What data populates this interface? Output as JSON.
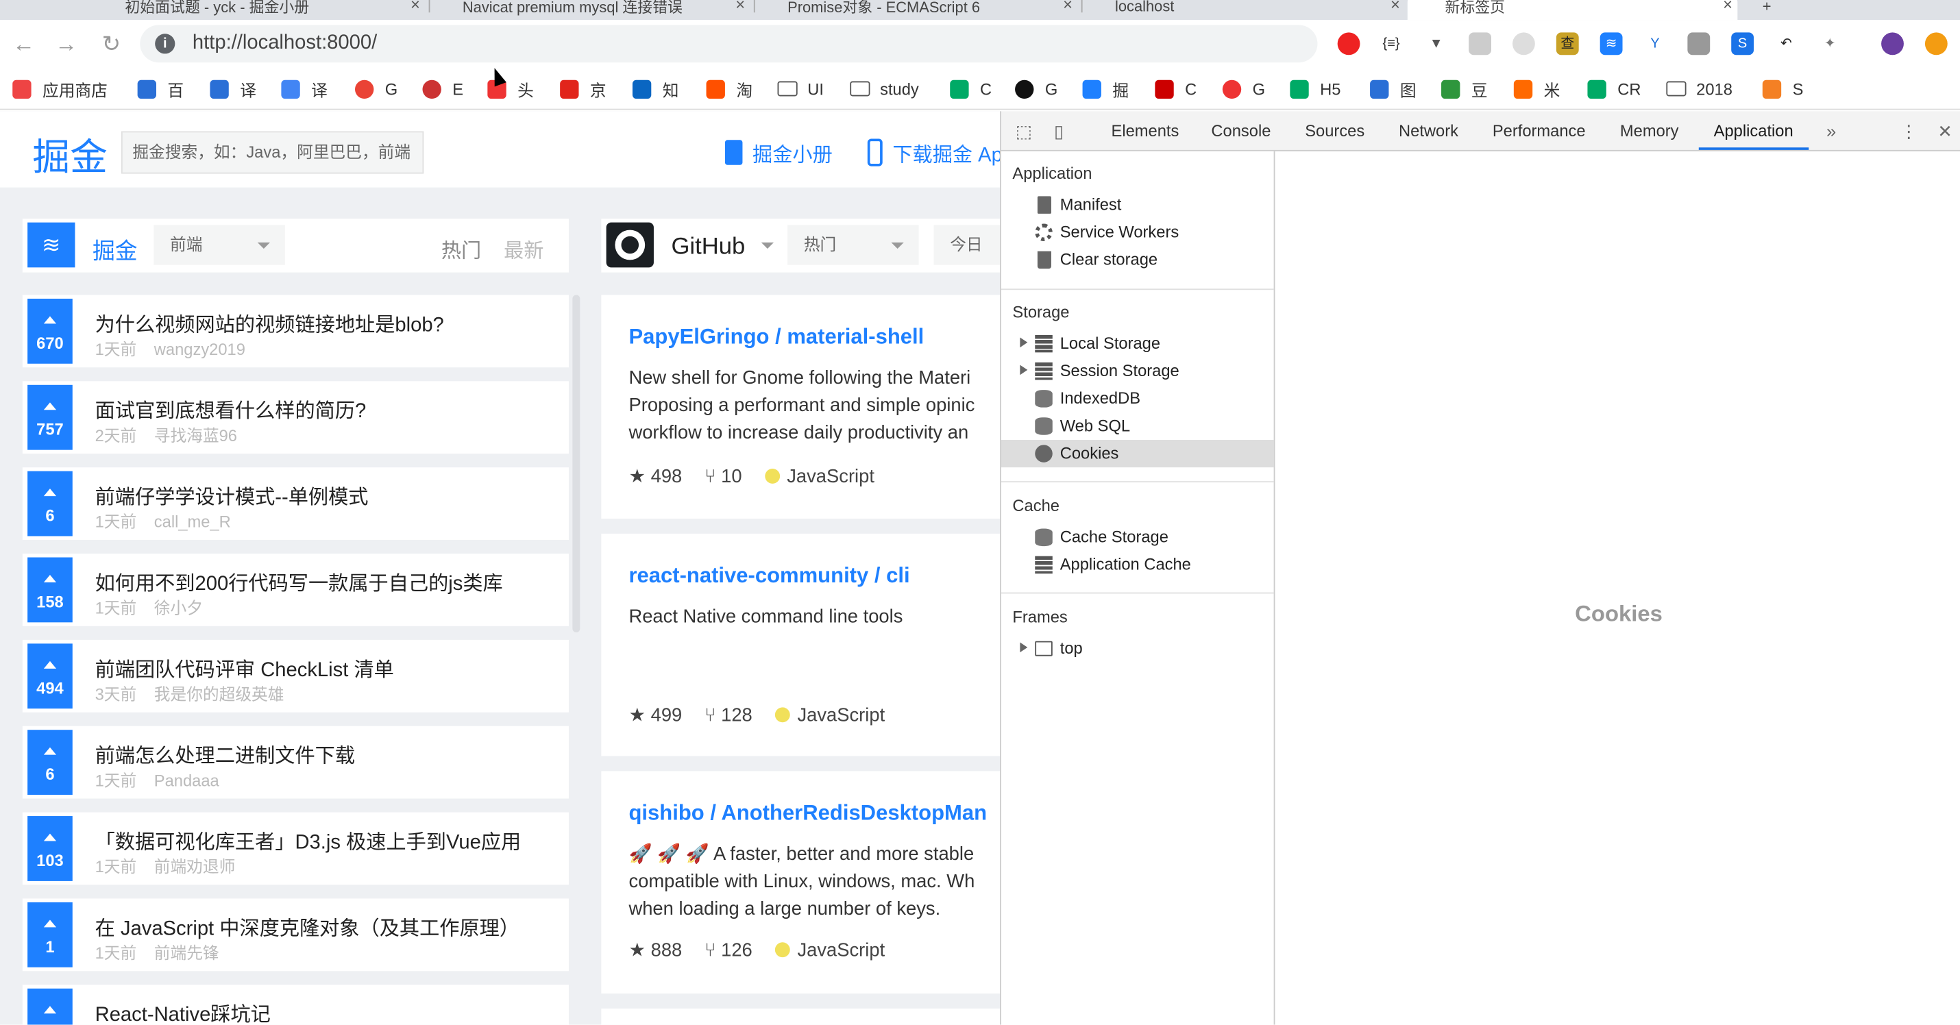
{
  "browser": {
    "tabs": [
      {
        "label": "初始面试题 - yck - 掘金小册"
      },
      {
        "label": "Navicat premium mysql 连接错误"
      },
      {
        "label": "Promise对象 - ECMAScript 6"
      },
      {
        "label": "localhost"
      },
      {
        "label": "新标签页"
      }
    ],
    "url": "http://localhost:8000/",
    "bookmarks": [
      {
        "label": "应用商店",
        "icon": "apps-icon",
        "color": "#e44"
      },
      {
        "label": "百",
        "icon": "baidu-icon",
        "color": "#2a6fd6"
      },
      {
        "label": "译",
        "icon": "translate-icon",
        "color": "#2a6fd6"
      },
      {
        "label": "译",
        "icon": "google-translate-icon",
        "color": "#4285f4"
      },
      {
        "label": "G",
        "icon": "google-icon",
        "color": "#ea4335"
      },
      {
        "label": "E",
        "icon": "e-icon",
        "color": "#c33"
      },
      {
        "label": "头",
        "icon": "toutiao-icon",
        "color": "#e33"
      },
      {
        "label": "京",
        "icon": "jd-icon",
        "color": "#e1251b"
      },
      {
        "label": "知",
        "icon": "zhihu-icon",
        "color": "#0a66c2"
      },
      {
        "label": "淘",
        "icon": "taobao-icon",
        "color": "#ff5000"
      },
      {
        "label": "UI",
        "icon": "folder-icon",
        "color": "#555"
      },
      {
        "label": "study",
        "icon": "folder-icon",
        "color": "#555"
      },
      {
        "label": "C",
        "icon": "c-icon",
        "color": "#0a6"
      },
      {
        "label": "G",
        "icon": "github-icon",
        "color": "#111"
      },
      {
        "label": "掘",
        "icon": "juejin-icon",
        "color": "#1e80ff"
      },
      {
        "label": "C",
        "icon": "csdn-icon",
        "color": "#c00"
      },
      {
        "label": "G",
        "icon": "g-icon",
        "color": "#e33"
      },
      {
        "label": "H5",
        "icon": "h5-icon",
        "color": "#0a6"
      },
      {
        "label": "图",
        "icon": "baidu-image-icon",
        "color": "#2a6fd6"
      },
      {
        "label": "豆",
        "icon": "douban-icon",
        "color": "#2e963d"
      },
      {
        "label": "米",
        "icon": "mi-icon",
        "color": "#ff6900"
      },
      {
        "label": "CR",
        "icon": "cr-icon",
        "color": "#0a6"
      },
      {
        "label": "2018",
        "icon": "folder-icon",
        "color": "#555"
      },
      {
        "label": "S",
        "icon": "stackoverflow-icon",
        "color": "#f48024"
      }
    ]
  },
  "juejin": {
    "logo": "掘金",
    "search_placeholder": "掘金搜索，如：Java，阿里巴巴，前端",
    "link_book": "掘金小册",
    "link_download": "下载掘金 App",
    "left_column": {
      "name": "掘金",
      "category": "前端",
      "hot": "热门",
      "new": "最新"
    },
    "articles": [
      {
        "votes": "670",
        "title": "为什么视频网站的视频链接地址是blob?",
        "time": "1天前",
        "author": "wangzy2019"
      },
      {
        "votes": "757",
        "title": "面试官到底想看什么样的简历?",
        "time": "2天前",
        "author": "寻找海蓝96"
      },
      {
        "votes": "6",
        "title": "前端仔学学设计模式--单例模式",
        "time": "1天前",
        "author": "call_me_R"
      },
      {
        "votes": "158",
        "title": "如何用不到200行代码写一款属于自己的js类库",
        "time": "1天前",
        "author": "徐小夕"
      },
      {
        "votes": "494",
        "title": "前端团队代码评审 CheckList 清单",
        "time": "3天前",
        "author": "我是你的超级英雄"
      },
      {
        "votes": "6",
        "title": "前端怎么处理二进制文件下载",
        "time": "1天前",
        "author": "Pandaaa"
      },
      {
        "votes": "103",
        "title": "「数据可视化库王者」D3.js 极速上手到Vue应用",
        "time": "1天前",
        "author": "前端劝退师"
      },
      {
        "votes": "1",
        "title": "在 JavaScript 中深度克隆对象（及其工作原理）",
        "time": "1天前",
        "author": "前端先锋"
      },
      {
        "votes": "",
        "title": "React-Native踩坑记",
        "time": "",
        "author": ""
      }
    ],
    "github_column": {
      "name": "GitHub",
      "sort": "热门",
      "period": "今日"
    },
    "repos": [
      {
        "name": "PapyElGringo / material-shell",
        "desc": [
          "New shell for Gnome following the Materi",
          "Proposing a performant and simple opinic",
          "workflow to increase daily productivity an"
        ],
        "stars": "498",
        "forks": "10",
        "lang": "JavaScript"
      },
      {
        "name": "react-native-community / cli",
        "desc": [
          "React Native command line tools"
        ],
        "stars": "499",
        "forks": "128",
        "lang": "JavaScript"
      },
      {
        "name": "qishibo / AnotherRedisDesktopMan",
        "desc": [
          "🚀 🚀 🚀 A faster, better and more stable",
          "compatible with Linux, windows, mac. Wh",
          "when loading a large number of keys."
        ],
        "stars": "888",
        "forks": "126",
        "lang": "JavaScript"
      }
    ]
  },
  "devtools": {
    "tabs": [
      "Elements",
      "Console",
      "Sources",
      "Network",
      "Performance",
      "Memory",
      "Application"
    ],
    "active_tab": "Application",
    "sections": {
      "application": {
        "title": "Application",
        "items": [
          "Manifest",
          "Service Workers",
          "Clear storage"
        ]
      },
      "storage": {
        "title": "Storage",
        "items": [
          "Local Storage",
          "Session Storage",
          "IndexedDB",
          "Web SQL",
          "Cookies"
        ]
      },
      "cache": {
        "title": "Cache",
        "items": [
          "Cache Storage",
          "Application Cache"
        ]
      },
      "frames": {
        "title": "Frames",
        "items": [
          "top"
        ]
      }
    },
    "selected_item": "Cookies",
    "main_placeholder": "Cookies"
  }
}
